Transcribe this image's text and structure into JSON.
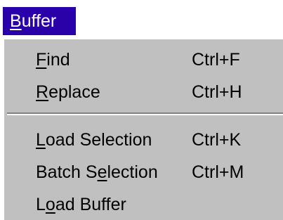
{
  "menu_bar": {
    "title_mnemonic": "B",
    "title_rest": "uffer"
  },
  "menu": {
    "items": [
      {
        "pre": "",
        "mnemonic": "F",
        "post": "ind",
        "shortcut": "Ctrl+F"
      },
      {
        "pre": "",
        "mnemonic": "R",
        "post": "eplace",
        "shortcut": "Ctrl+H"
      },
      {
        "pre": "",
        "mnemonic": "L",
        "post": "oad Selection",
        "shortcut": "Ctrl+K"
      },
      {
        "pre": "Batch S",
        "mnemonic": "e",
        "post": "lection",
        "shortcut": "Ctrl+M"
      },
      {
        "pre": "L",
        "mnemonic": "o",
        "post": "ad Buffer",
        "shortcut": ""
      }
    ]
  },
  "colors": {
    "menu_title_bg": "#2a00a8",
    "menu_bg": "#c0c0c0",
    "separator_shadow": "#808080"
  }
}
